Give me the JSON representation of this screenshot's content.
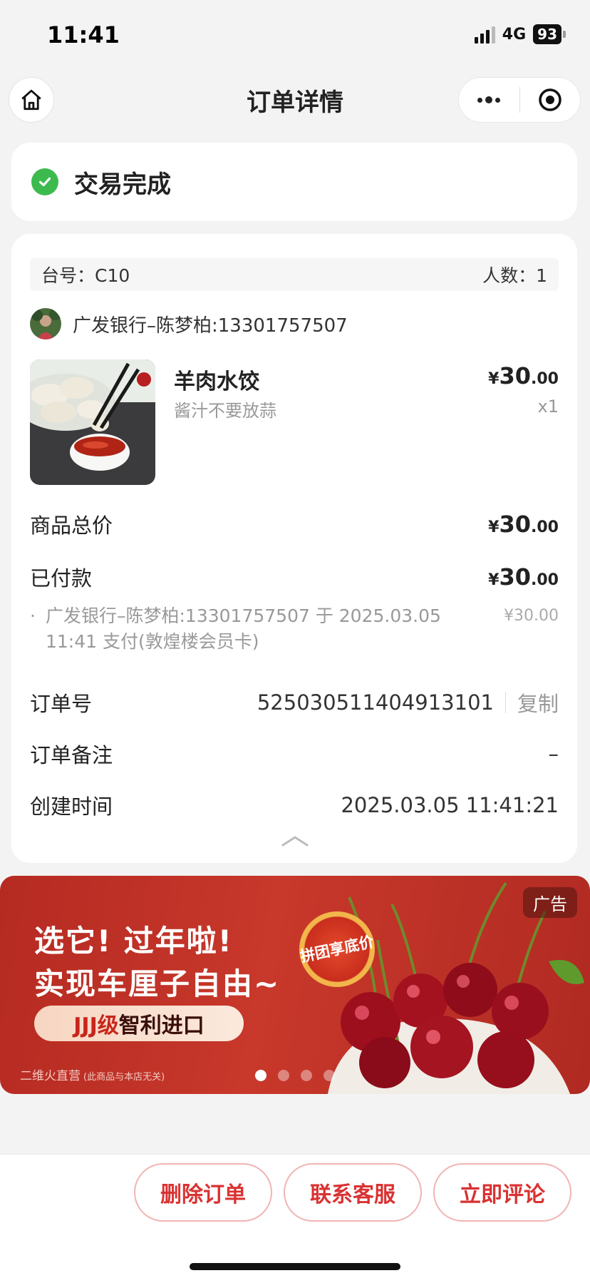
{
  "status_bar": {
    "time": "11:41",
    "network": "4G",
    "battery": "93"
  },
  "nav": {
    "title": "订单详情"
  },
  "order_status": {
    "text": "交易完成"
  },
  "table_info": {
    "table_label": "台号：C10",
    "people_label": "人数：1"
  },
  "payer": {
    "name": "广发银行–陈梦柏:13301757507"
  },
  "product": {
    "name": "羊肉水饺",
    "note": "酱汁不要放蒜",
    "price": {
      "currency": "¥",
      "int": "30",
      "dec": ".00"
    },
    "qty": "x1"
  },
  "summary": {
    "total_label": "商品总价",
    "total": {
      "currency": "¥",
      "int": "30",
      "dec": ".00"
    },
    "paid_label": "已付款",
    "paid": {
      "currency": "¥",
      "int": "30",
      "dec": ".00"
    },
    "pay_detail_bullet": "·",
    "pay_detail": "广发银行–陈梦柏:13301757507 于 2025.03.05 11:41 支付(敦煌楼会员卡)",
    "pay_detail_amount": "¥30.00"
  },
  "order_info": {
    "order_no_label": "订单号",
    "order_no": "525030511404913101",
    "copy_label": "复制",
    "remark_label": "订单备注",
    "remark": "–",
    "created_label": "创建时间",
    "created": "2025.03.05 11:41:21"
  },
  "ad": {
    "tag": "广告",
    "line1": "选它! 过年啦!",
    "line2": "实现车厘子自由~",
    "cta_highlight": "JJJ级",
    "cta_rest": "智利进口",
    "badge": "拼团享底价",
    "footer": "二维火直营",
    "footer_sub": "(此商品与本店无关)",
    "slide_count": 4,
    "active_slide": 0
  },
  "actions": {
    "delete": "删除订单",
    "contact": "联系客服",
    "review": "立即评论"
  },
  "colors": {
    "accent": "#d93232",
    "success": "#3dba4e",
    "page_bg": "#f3f3f3"
  },
  "icons": [
    "home-icon",
    "more-icon",
    "close-miniprogram-icon",
    "check-circle-icon",
    "chevron-up-icon"
  ]
}
